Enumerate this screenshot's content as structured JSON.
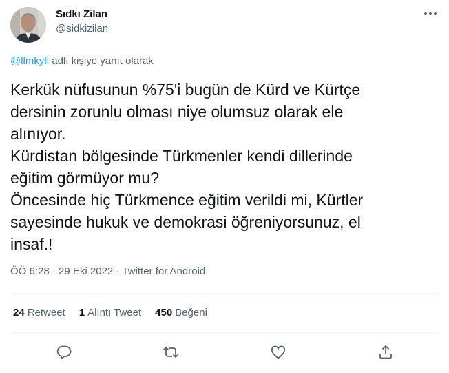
{
  "author": {
    "display_name": "Sıdkı Zilan",
    "handle": "@sidkizilan"
  },
  "reply": {
    "mention": "@llmkyll",
    "suffix": " adlı kişiye yanıt olarak"
  },
  "tweet": {
    "text": "Kerkük nüfusunun %75'i bugün de Kürd ve Kürtçe\ndersinin zorunlu olması niye olumsuz olarak ele\nalınıyor.\nKürdistan bölgesinde Türkmenler kendi dillerinde\neğitim görmüyor mu?\nÖncesinde hiç Türkmence eğitim verildi mi, Kürtler\nsayesinde hukuk ve demokrasi öğreniyorsunuz, el\ninsaf.!",
    "time": "ÖÖ 6:28",
    "date": "29 Eki 2022",
    "source": "Twitter for Android",
    "separator": "·"
  },
  "stats": {
    "retweets": {
      "count": "24",
      "label": "Retweet"
    },
    "quotes": {
      "count": "1",
      "label": "Alıntı Tweet"
    },
    "likes": {
      "count": "450",
      "label": "Beğeni"
    }
  },
  "icons": {
    "more": "more-dots-icon",
    "reply": "reply-bubble-icon",
    "retweet": "retweet-arrows-icon",
    "like": "heart-outline-icon",
    "share": "share-upload-icon"
  },
  "colors": {
    "text": "#0f1419",
    "secondary": "#536471",
    "link": "#1d9bf0",
    "divider": "#eff3f4"
  }
}
